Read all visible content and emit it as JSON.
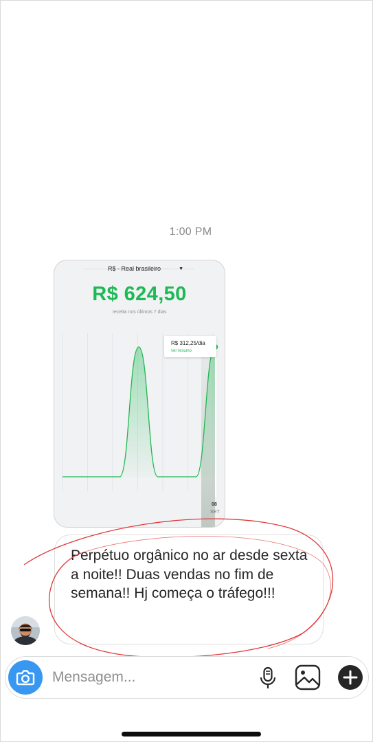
{
  "thread": {
    "timestamp": "1:00 PM"
  },
  "screenshot": {
    "currency_label": "R$ - Real brasileiro",
    "revenue": "R$ 624,50",
    "revenue_caption": "receita nos últimos 7 dias",
    "tooltip_value": "R$ 312,25/dia",
    "tooltip_link": "ver resumo",
    "x_day": "08",
    "x_month": "SET",
    "accent_color": "#1db954"
  },
  "chart_data": {
    "type": "area",
    "values": [
      0,
      0,
      0,
      0,
      312.25,
      0,
      0,
      0,
      312.25
    ],
    "peak_value": 312.25,
    "total": 624.5,
    "tick_labels": [
      {
        "day": "08",
        "month": "SET"
      }
    ]
  },
  "message": {
    "text": "Perpétuo orgânico no ar desde sexta a noite!! Duas vendas no fim de semana!! Hj começa o tráfego!!!"
  },
  "composer": {
    "placeholder": "Mensagem...",
    "icons": [
      "camera-icon",
      "microphone-icon",
      "gallery-icon",
      "plus-icon"
    ],
    "accent_color": "#3897f0"
  }
}
